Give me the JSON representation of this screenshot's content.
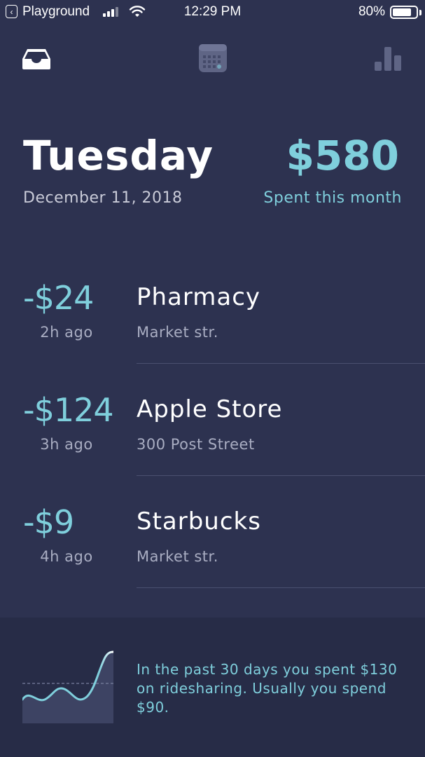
{
  "status_bar": {
    "back_app": "Playground",
    "time": "12:29 PM",
    "battery_percent": "80%",
    "battery_level": 0.8
  },
  "nav": {
    "icons": [
      "inbox-icon",
      "calendar-icon",
      "bar-chart-icon"
    ],
    "active": "inbox-icon"
  },
  "header": {
    "day": "Tuesday",
    "date": "December 11, 2018",
    "total": "$580",
    "total_caption": "Spent this month"
  },
  "transactions": [
    {
      "amount": "-$24",
      "time": "2h ago",
      "merchant": "Pharmacy",
      "location": "Market str."
    },
    {
      "amount": "-$124",
      "time": "3h ago",
      "merchant": "Apple Store",
      "location": "300 Post Street"
    },
    {
      "amount": "-$9",
      "time": "4h ago",
      "merchant": "Starbucks",
      "location": "Market str."
    }
  ],
  "insight": {
    "text": "In the past 30 days you spent $130 on ridesharing. Usually you spend $90."
  },
  "colors": {
    "background": "#2d3250",
    "accent": "#7fcfdc",
    "muted_text": "#a9adc2",
    "insight_bg": "#272c47"
  }
}
